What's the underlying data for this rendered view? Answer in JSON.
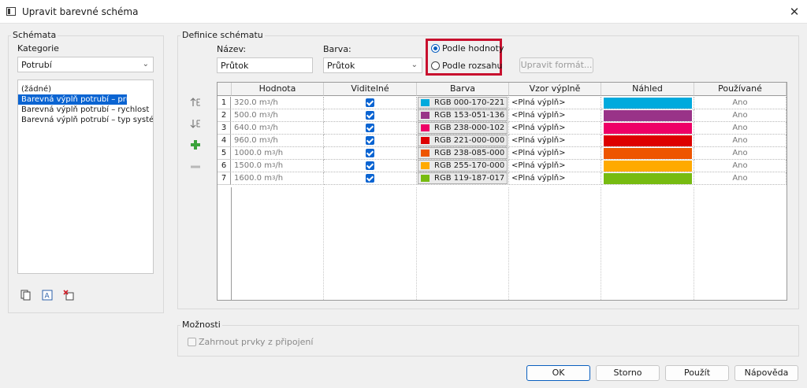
{
  "window": {
    "title": "Upravit barevné schéma",
    "close_label": "✕"
  },
  "schemes": {
    "group_label": "Schémata",
    "category_label": "Kategorie",
    "category_value": "Potrubí",
    "items": [
      {
        "label": "(žádné)"
      },
      {
        "label": "Barevná výplň potrubí – průtok"
      },
      {
        "label": "Barevná výplň potrubí – rychlost"
      },
      {
        "label": "Barevná výplň potrubí – typ systému"
      }
    ],
    "selected_index": 1,
    "toolbar_icons": [
      "duplicate-icon",
      "rename-icon",
      "delete-icon"
    ]
  },
  "definition": {
    "group_label": "Definice schématu",
    "name_label": "Název:",
    "name_value": "Průtok",
    "color_label": "Barva:",
    "color_value": "Průtok",
    "radio_by_value": "Podle hodnoty",
    "radio_by_range": "Podle rozsahu",
    "selected_mode": "by_value",
    "edit_format_label": "Upravit formát...",
    "side_icons": [
      "move-up-icon",
      "move-down-icon",
      "add-icon",
      "remove-icon"
    ],
    "columns": [
      "Hodnota",
      "Viditelné",
      "Barva",
      "Vzor výplně",
      "Náhled",
      "Používané"
    ],
    "unit_base": "m",
    "unit_exp": "3",
    "unit_suffix": "/h",
    "rows": [
      {
        "num": "1",
        "value": "320.0",
        "visible": true,
        "color": "RGB 000-170-221",
        "hex": "#00aadd",
        "pattern": "<Plná výplň>",
        "used": "Ano"
      },
      {
        "num": "2",
        "value": "500.0",
        "visible": true,
        "color": "RGB 153-051-136",
        "hex": "#993388",
        "pattern": "<Plná výplň>",
        "used": "Ano"
      },
      {
        "num": "3",
        "value": "640.0",
        "visible": true,
        "color": "RGB 238-000-102",
        "hex": "#ee0066",
        "pattern": "<Plná výplň>",
        "used": "Ano"
      },
      {
        "num": "4",
        "value": "960.0",
        "visible": true,
        "color": "RGB 221-000-000",
        "hex": "#dd0000",
        "pattern": "<Plná výplň>",
        "used": "Ano"
      },
      {
        "num": "5",
        "value": "1000.0",
        "visible": true,
        "color": "RGB 238-085-000",
        "hex": "#ee5500",
        "pattern": "<Plná výplň>",
        "used": "Ano"
      },
      {
        "num": "6",
        "value": "1500.0",
        "visible": true,
        "color": "RGB 255-170-000",
        "hex": "#ffaa00",
        "pattern": "<Plná výplň>",
        "used": "Ano"
      },
      {
        "num": "7",
        "value": "1600.0",
        "visible": true,
        "color": "RGB 119-187-017",
        "hex": "#77bb11",
        "pattern": "<Plná výplň>",
        "used": "Ano"
      }
    ]
  },
  "options": {
    "group_label": "Možnosti",
    "include_linked_label": "Zahrnout prvky z připojení",
    "include_linked_checked": false
  },
  "buttons": {
    "ok": "OK",
    "cancel": "Storno",
    "apply": "Použít",
    "help": "Nápověda"
  },
  "colors": {
    "selection": "#0a64d2",
    "highlight": "#c8102e"
  }
}
